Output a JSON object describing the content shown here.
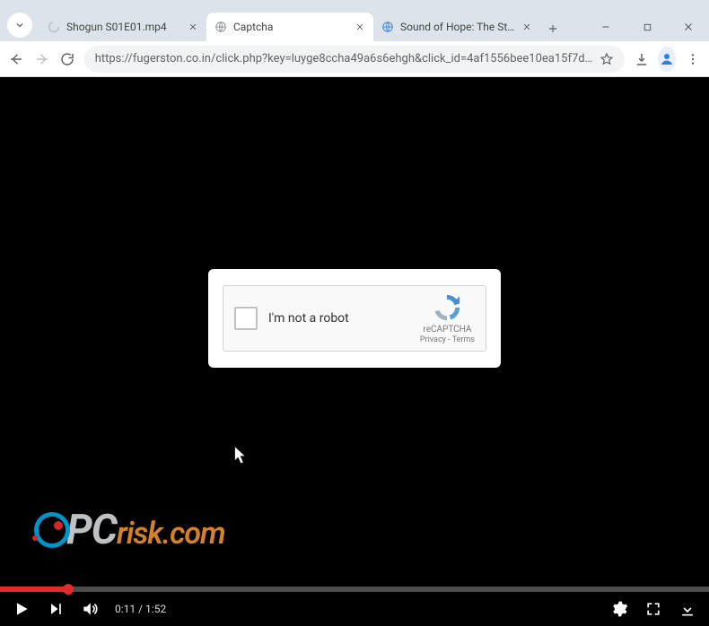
{
  "browser": {
    "tabs": [
      {
        "title": "Shogun S01E01.mp4",
        "favicon": "spinner"
      },
      {
        "title": "Captcha",
        "favicon": "globe",
        "active": true
      },
      {
        "title": "Sound of Hope: The Story o",
        "favicon": "globe-blue"
      }
    ],
    "url_protocol": "https://",
    "url_rest": "fugerston.co.in/click.php?key=luyge8ccha49a6s6ehgh&click_id=4af1556bee10ea15f7d…"
  },
  "captcha": {
    "label": "I'm not a robot",
    "brand": "reCAPTCHA",
    "privacy": "Privacy",
    "terms": "Terms",
    "dash": " - "
  },
  "watermark": {
    "p": "P",
    "c": "C",
    "r": "r",
    "rest": "isk.com"
  },
  "video": {
    "played_pct": 9.6,
    "current": "0:11",
    "separator": " / ",
    "duration": "1:52"
  }
}
